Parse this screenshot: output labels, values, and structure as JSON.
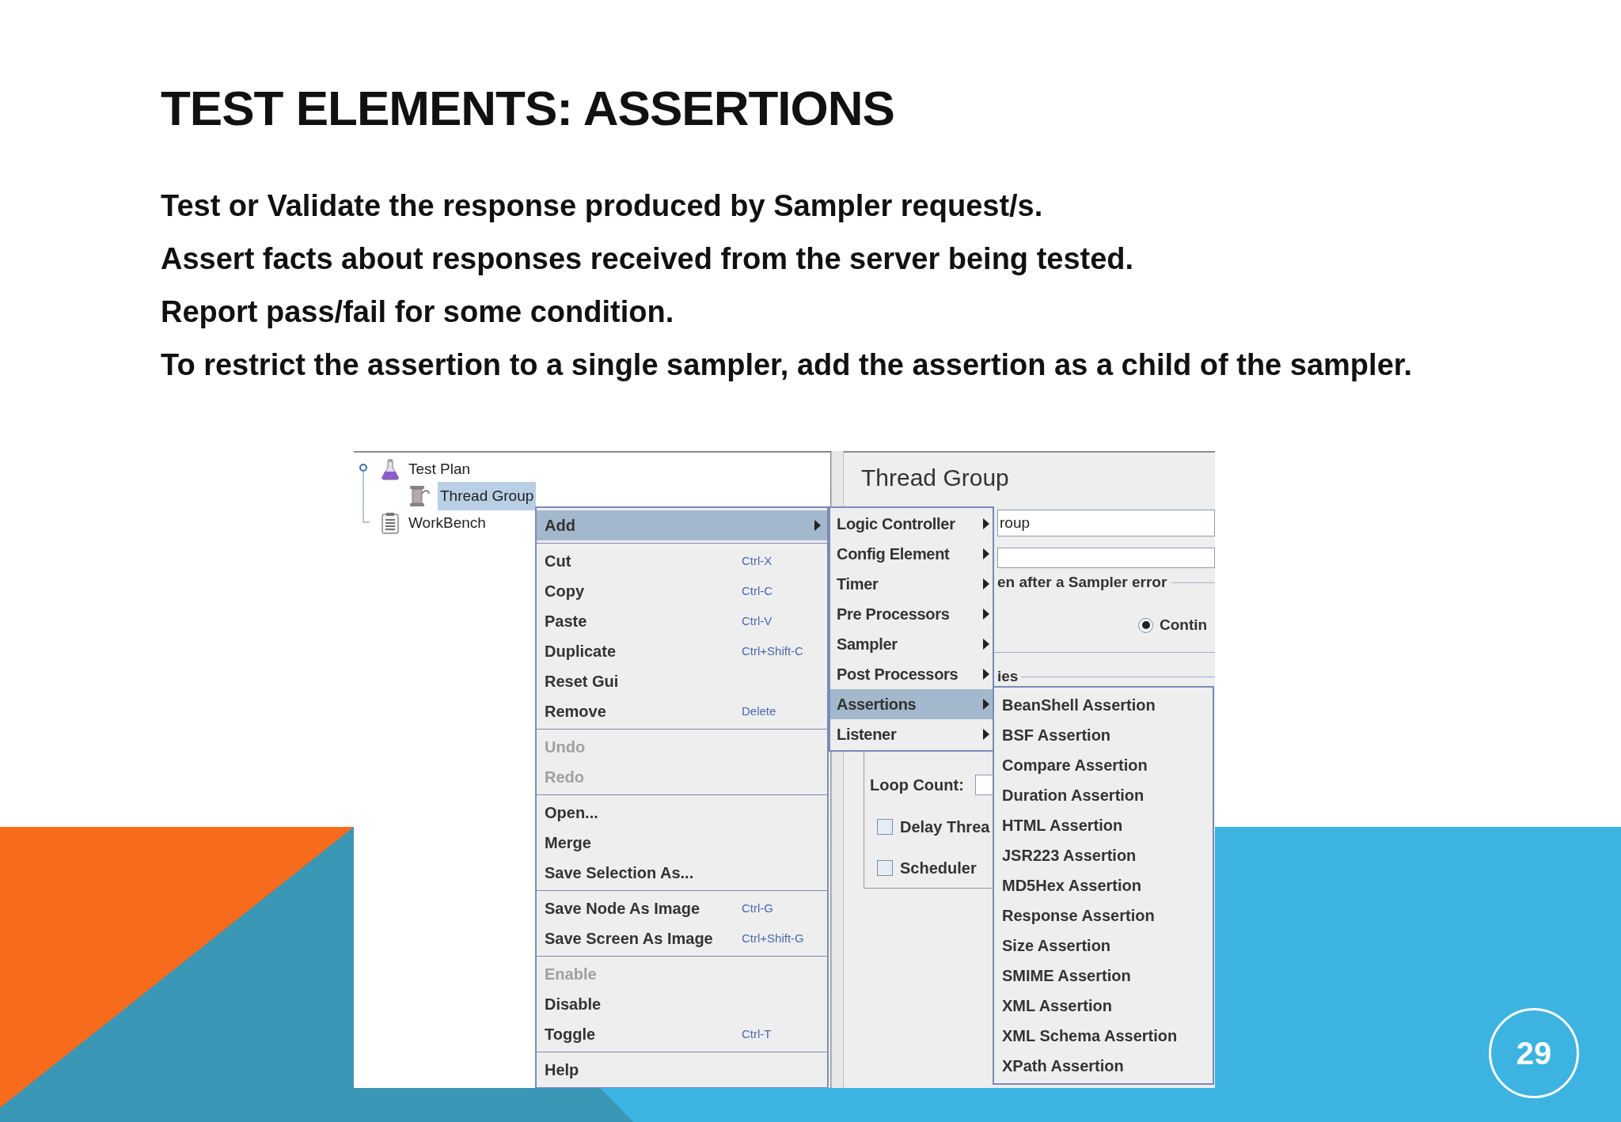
{
  "slide": {
    "title": "TEST ELEMENTS: ASSERTIONS",
    "bullets": [
      "Test or Validate the response produced by Sampler request/s.",
      "Assert facts about responses received from the server being tested.",
      "Report pass/fail for some condition.",
      "To restrict the assertion to a single sampler, add the assertion as a child of the sampler."
    ],
    "page_number": "29"
  },
  "screenshot": {
    "tree": [
      {
        "label": "Test Plan",
        "kind": "plan",
        "selected": false,
        "children": [
          {
            "label": "Thread Group",
            "kind": "threads",
            "selected": true
          }
        ]
      },
      {
        "label": "WorkBench",
        "kind": "workbench",
        "selected": false
      }
    ],
    "panel": {
      "title": "Thread Group",
      "name_value": "roup",
      "error_label": "en after a Sampler error",
      "radio": {
        "label": "Contin",
        "selected": true
      },
      "section_label": "ies",
      "loop_count_label": "Loop Count:",
      "checkboxes": [
        {
          "label": "Delay Threa",
          "checked": false
        },
        {
          "label": "Scheduler",
          "checked": false
        }
      ]
    },
    "context_menu": [
      [
        {
          "label": "Add",
          "submenu": true,
          "selected": true,
          "disabled": false
        }
      ],
      [
        {
          "label": "Cut",
          "shortcut": "Ctrl-X",
          "selected": false,
          "disabled": false
        },
        {
          "label": "Copy",
          "shortcut": "Ctrl-C",
          "selected": false,
          "disabled": false
        },
        {
          "label": "Paste",
          "shortcut": "Ctrl-V",
          "selected": false,
          "disabled": false
        },
        {
          "label": "Duplicate",
          "shortcut": "Ctrl+Shift-C",
          "selected": false,
          "disabled": false
        },
        {
          "label": "Reset Gui",
          "selected": false,
          "disabled": false
        },
        {
          "label": "Remove",
          "shortcut": "Delete",
          "selected": false,
          "disabled": false
        }
      ],
      [
        {
          "label": "Undo",
          "selected": false,
          "disabled": true
        },
        {
          "label": "Redo",
          "selected": false,
          "disabled": true
        }
      ],
      [
        {
          "label": "Open...",
          "selected": false,
          "disabled": false
        },
        {
          "label": "Merge",
          "selected": false,
          "disabled": false
        },
        {
          "label": "Save Selection As...",
          "selected": false,
          "disabled": false
        }
      ],
      [
        {
          "label": "Save Node As Image",
          "shortcut": "Ctrl-G",
          "selected": false,
          "disabled": false
        },
        {
          "label": "Save Screen As Image",
          "shortcut": "Ctrl+Shift-G",
          "selected": false,
          "disabled": false
        }
      ],
      [
        {
          "label": "Enable",
          "selected": false,
          "disabled": true
        },
        {
          "label": "Disable",
          "selected": false,
          "disabled": false
        },
        {
          "label": "Toggle",
          "shortcut": "Ctrl-T",
          "selected": false,
          "disabled": false
        }
      ],
      [
        {
          "label": "Help",
          "selected": false,
          "disabled": false
        }
      ]
    ],
    "add_submenu": [
      {
        "label": "Logic Controller",
        "selected": false
      },
      {
        "label": "Config Element",
        "selected": false
      },
      {
        "label": "Timer",
        "selected": false
      },
      {
        "label": "Pre Processors",
        "selected": false
      },
      {
        "label": "Sampler",
        "selected": false
      },
      {
        "label": "Post Processors",
        "selected": false
      },
      {
        "label": "Assertions",
        "selected": true
      },
      {
        "label": "Listener",
        "selected": false
      }
    ],
    "assertions_submenu": [
      "BeanShell Assertion",
      "BSF Assertion",
      "Compare Assertion",
      "Duration Assertion",
      "HTML Assertion",
      "JSR223 Assertion",
      "MD5Hex Assertion",
      "Response Assertion",
      "Size Assertion",
      "SMIME Assertion",
      "XML Assertion",
      "XML Schema Assertion",
      "XPath Assertion"
    ]
  }
}
